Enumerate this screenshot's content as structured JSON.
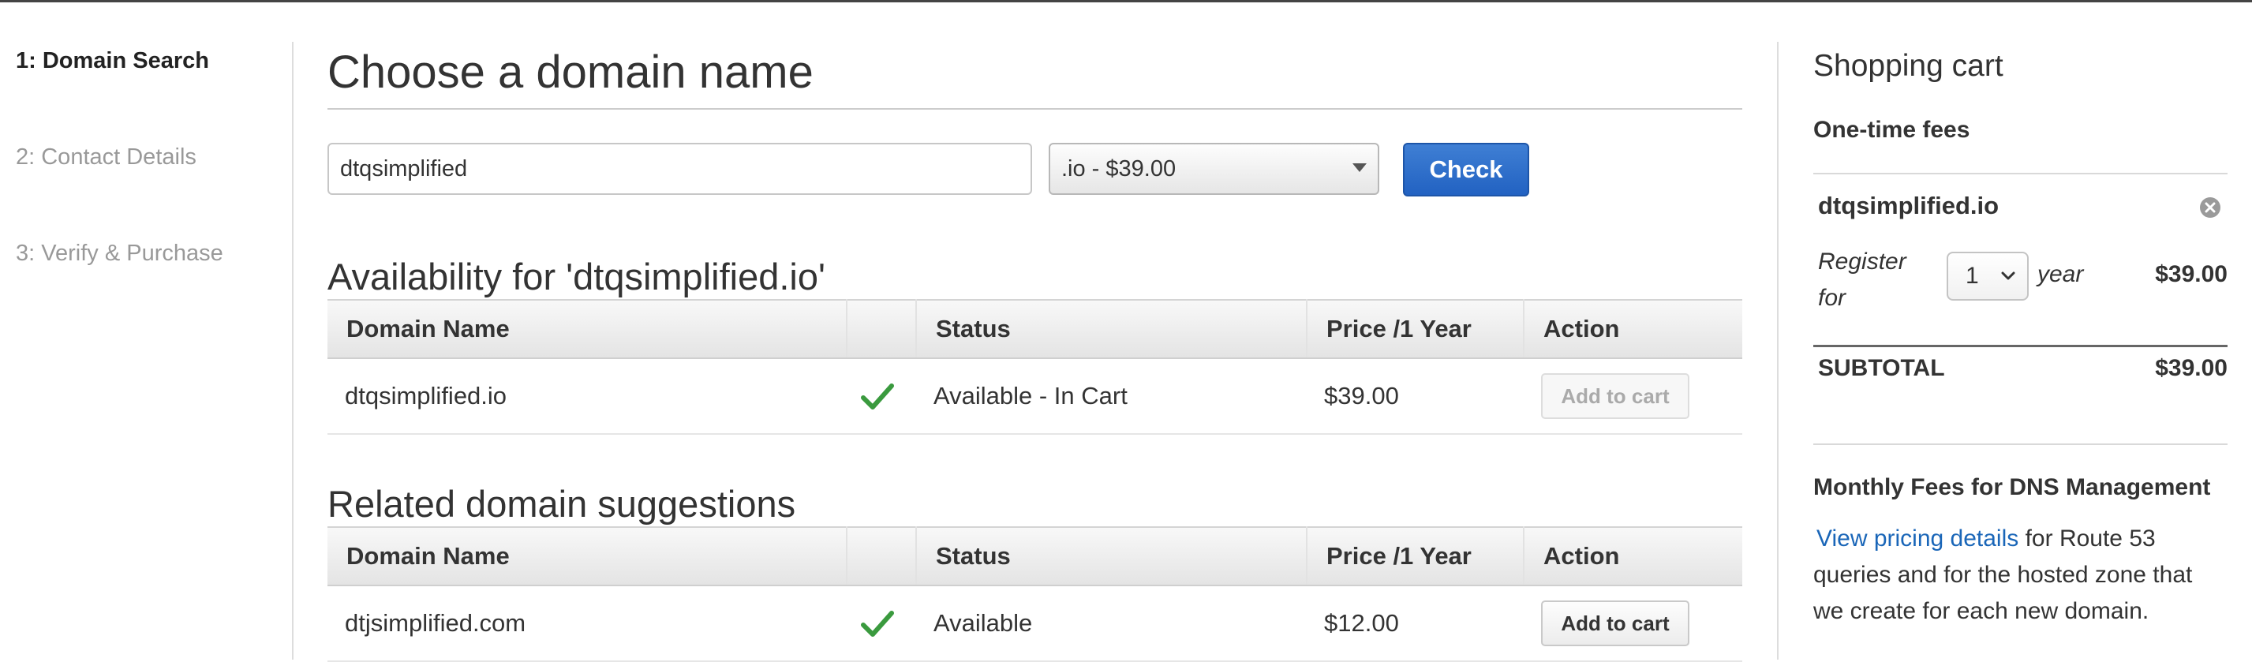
{
  "steps": [
    {
      "label": "1: Domain Search",
      "active": true
    },
    {
      "label": "2: Contact Details",
      "active": false
    },
    {
      "label": "3: Verify & Purchase",
      "active": false
    }
  ],
  "main": {
    "title": "Choose a domain name",
    "search": {
      "input_value": "dtqsimplified",
      "tld_selected": ".io - $39.00",
      "check_label": "Check"
    },
    "availability": {
      "title": "Availability for 'dtqsimplified.io'",
      "columns": [
        "Domain Name",
        "",
        "Status",
        "Price /1 Year",
        "Action"
      ],
      "rows": [
        {
          "domain": "dtqsimplified.io",
          "status": "Available - In Cart",
          "price": "$39.00",
          "action": "Add to cart",
          "action_enabled": false
        }
      ]
    },
    "suggestions": {
      "title": "Related domain suggestions",
      "columns": [
        "Domain Name",
        "",
        "Status",
        "Price /1 Year",
        "Action"
      ],
      "rows": [
        {
          "domain": "dtjsimplified.com",
          "status": "Available",
          "price": "$12.00",
          "action": "Add to cart",
          "action_enabled": true
        }
      ]
    }
  },
  "cart": {
    "title": "Shopping cart",
    "fees_label": "One-time fees",
    "item": {
      "name": "dtqsimplified.io",
      "register_label": "Register for",
      "years_selected": "1",
      "year_label": "year",
      "price": "$39.00"
    },
    "subtotal_label": "SUBTOTAL",
    "subtotal_value": "$39.00",
    "monthly_title": "Monthly Fees for DNS Management",
    "pricing_link": "View pricing details",
    "monthly_text": "for Route 53 queries and for the hosted zone that we create for each new domain."
  },
  "colors": {
    "primary_button": "#2a6bc8",
    "link": "#1a66b8",
    "checkmark": "#3a9a3e"
  }
}
